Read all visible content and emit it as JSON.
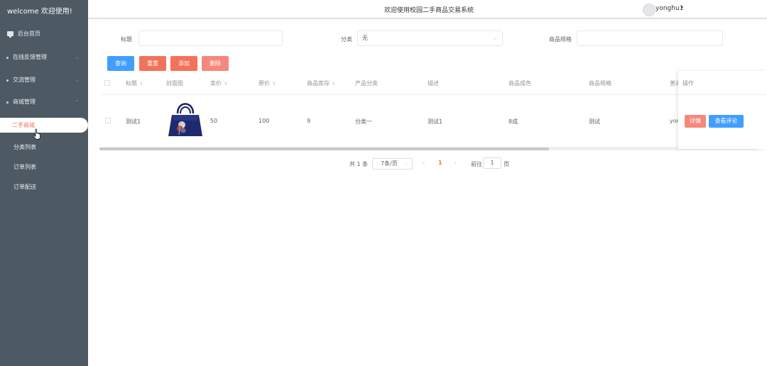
{
  "sidebar": {
    "brand": "welcome 欢迎使用!",
    "home": "后台首页",
    "menus": [
      {
        "label": "在线反馈管理",
        "chevron": "⌵"
      },
      {
        "label": "交流管理",
        "chevron": "⌵"
      },
      {
        "label": "商城管理",
        "chevron": "⌃"
      }
    ],
    "submenu": {
      "active": "二手商城",
      "items": [
        "分类列表",
        "订单列表",
        "订单配送"
      ]
    }
  },
  "header": {
    "title": "欢迎使用校园二手商品交易系统",
    "username": "yonghu1",
    "caret": "▾"
  },
  "filters": {
    "title_label": "标题",
    "title_value": "",
    "category_label": "分类",
    "category_value": "无",
    "spec_label": "商品规格",
    "spec_value": ""
  },
  "actions": {
    "query": "查询",
    "reset": "重置",
    "add": "添加",
    "delete": "删除"
  },
  "colors": {
    "sidebar_bg": "#4d5a64",
    "primary": "#409eff",
    "danger": "#f2725b",
    "accent_light": "#f5887b"
  },
  "table": {
    "columns": [
      "标题",
      "封面图",
      "卖价",
      "原价",
      "商品库存",
      "产品分类",
      "描述",
      "商品成色",
      "商品规格",
      "普通",
      "操作"
    ],
    "rows": [
      {
        "title": "测试1",
        "cover": "handbag",
        "sell_price": "50",
        "orig_price": "100",
        "stock": "9",
        "category": "分类一",
        "desc": "测试1",
        "condition": "8成",
        "spec": "测试",
        "user": "yon",
        "btn_detail": "详情",
        "btn_reviews": "查看评论"
      }
    ]
  },
  "pagination": {
    "total": "共 1 条",
    "page_size": "7条/页",
    "current": "1",
    "goto_label": "前往",
    "goto_value": "1",
    "page_unit": "页"
  }
}
